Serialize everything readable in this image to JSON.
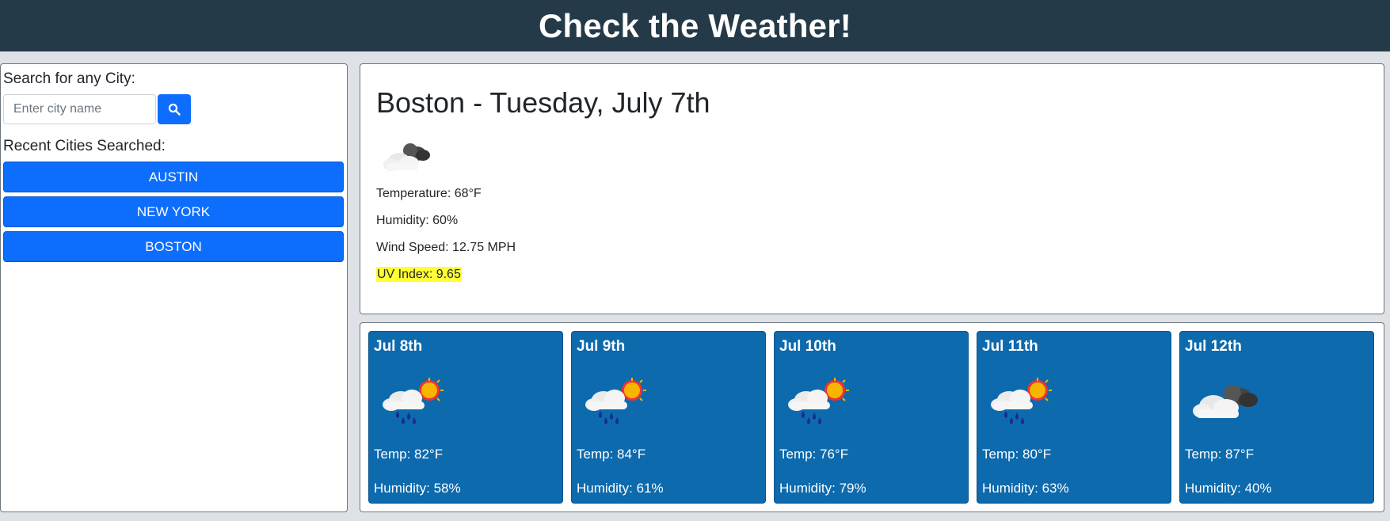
{
  "header": {
    "title": "Check the Weather!"
  },
  "sidebar": {
    "search_label": "Search for any City:",
    "search_placeholder": "Enter city name",
    "search_value": "",
    "search_button_icon": "search-icon",
    "recent_label": "Recent Cities Searched:",
    "recent_cities": [
      "AUSTIN",
      "NEW YORK",
      "BOSTON"
    ]
  },
  "current": {
    "title": "Boston - Tuesday, July 7th",
    "icon": "partly-cloudy-icon",
    "temperature": "Temperature: 68°F",
    "humidity": "Humidity: 60%",
    "wind": "Wind Speed: 12.75 MPH",
    "uv": "UV Index: 9.65",
    "uv_color": "#ffff33"
  },
  "forecast": [
    {
      "date": "Jul 8th",
      "icon": "rain-sun-icon",
      "temp": "Temp: 82°F",
      "humidity": "Humidity: 58%"
    },
    {
      "date": "Jul 9th",
      "icon": "rain-sun-icon",
      "temp": "Temp: 84°F",
      "humidity": "Humidity: 61%"
    },
    {
      "date": "Jul 10th",
      "icon": "rain-sun-icon",
      "temp": "Temp: 76°F",
      "humidity": "Humidity: 79%"
    },
    {
      "date": "Jul 11th",
      "icon": "rain-sun-icon",
      "temp": "Temp: 80°F",
      "humidity": "Humidity: 63%"
    },
    {
      "date": "Jul 12th",
      "icon": "partly-cloudy-icon",
      "temp": "Temp: 87°F",
      "humidity": "Humidity: 40%"
    }
  ],
  "colors": {
    "header_bg": "#253a48",
    "primary": "#0d6efd",
    "card_bg": "#0d6aad"
  }
}
